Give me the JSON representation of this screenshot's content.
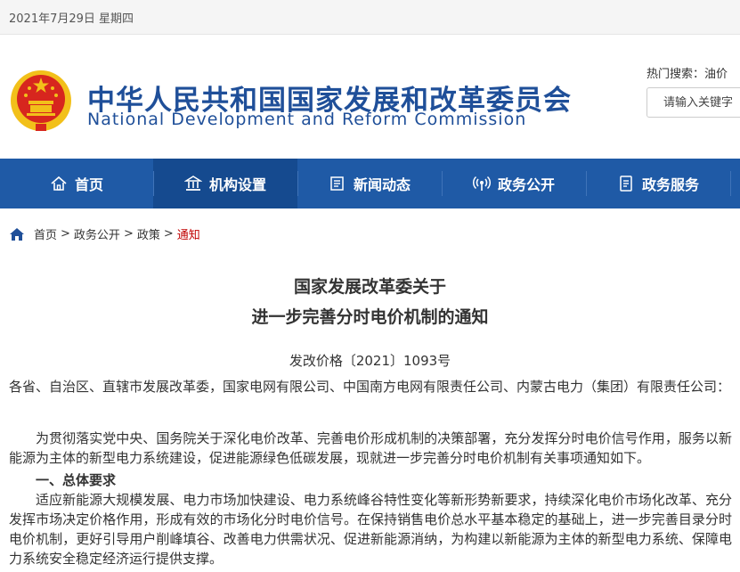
{
  "topbar": {
    "date": "2021年7月29日 星期四"
  },
  "header": {
    "title_cn": "中华人民共和国国家发展和改革委员会",
    "title_en": "National Development and Reform Commission",
    "hot_label": "热门搜索：",
    "hot_keyword": "油价",
    "search_placeholder": "请输入关键字"
  },
  "nav": {
    "items": [
      {
        "label": "首页",
        "icon": "home-icon"
      },
      {
        "label": "机构设置",
        "icon": "institution-icon"
      },
      {
        "label": "新闻动态",
        "icon": "news-icon"
      },
      {
        "label": "政务公开",
        "icon": "broadcast-icon"
      },
      {
        "label": "政务服务",
        "icon": "document-icon"
      }
    ],
    "active_index": 1
  },
  "breadcrumb": {
    "items": [
      "首页",
      "政务公开",
      "政策",
      "通知"
    ],
    "separator": ">"
  },
  "article": {
    "title_line1": "国家发展改革委关于",
    "title_line2": "进一步完善分时电价机制的通知",
    "doc_number": "发改价格〔2021〕1093号",
    "recipients": "各省、自治区、直辖市发展改革委，国家电网有限公司、中国南方电网有限责任公司、内蒙古电力（集团）有限责任公司：",
    "intro": "为贯彻落实党中央、国务院关于深化电价改革、完善电价形成机制的决策部署，充分发挥分时电价信号作用，服务以新能源为主体的新型电力系统建设，促进能源绿色低碳发展，现就进一步完善分时电价机制有关事项通知如下。",
    "section1_heading": "一、总体要求",
    "section1_body": "适应新能源大规模发展、电力市场加快建设、电力系统峰谷特性变化等新形势新要求，持续深化电价市场化改革、充分发挥市场决定价格作用，形成有效的市场化分时电价信号。在保持销售电价总水平基本稳定的基础上，进一步完善目录分时电价机制，更好引导用户削峰填谷、改善电力供需状况、促进新能源消纳，为构建以新能源为主体的新型电力系统、保障电力系统安全稳定经济运行提供支撑。"
  },
  "colors": {
    "nav_bg": "#1f5aa6",
    "nav_active_bg": "#154a8f",
    "brand_blue": "#1f4f99",
    "breadcrumb_current": "#c00000",
    "emblem_red": "#d7261e",
    "emblem_gold": "#f2c01a"
  }
}
